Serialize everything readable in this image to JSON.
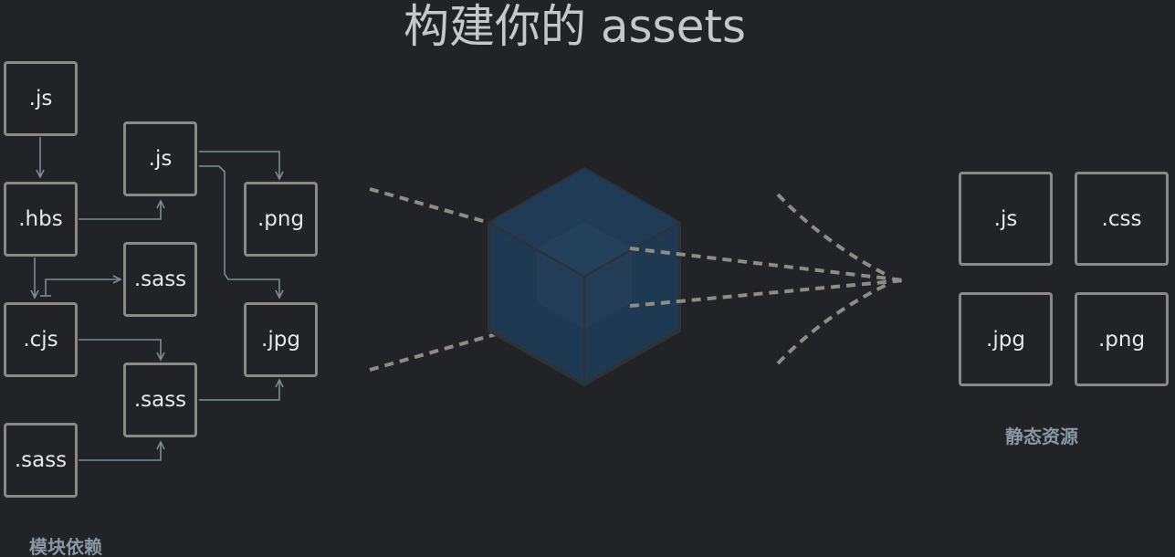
{
  "title": "构建你的 assets",
  "left_group": {
    "caption": "模块依赖",
    "modules": [
      ".js",
      ".hbs",
      ".cjs",
      ".sass",
      ".js",
      ".sass",
      ".sass",
      ".png",
      ".jpg"
    ]
  },
  "right_group": {
    "caption": "静态资源",
    "assets": [
      ".js",
      ".css",
      ".jpg",
      ".png"
    ]
  },
  "colors": {
    "background": "#212326",
    "box_border": "#8b8986",
    "connector": "#7f8c94",
    "cube_fill": "#1e3a52",
    "cube_edge": "#2d3237",
    "dash": "#8f8b86"
  }
}
